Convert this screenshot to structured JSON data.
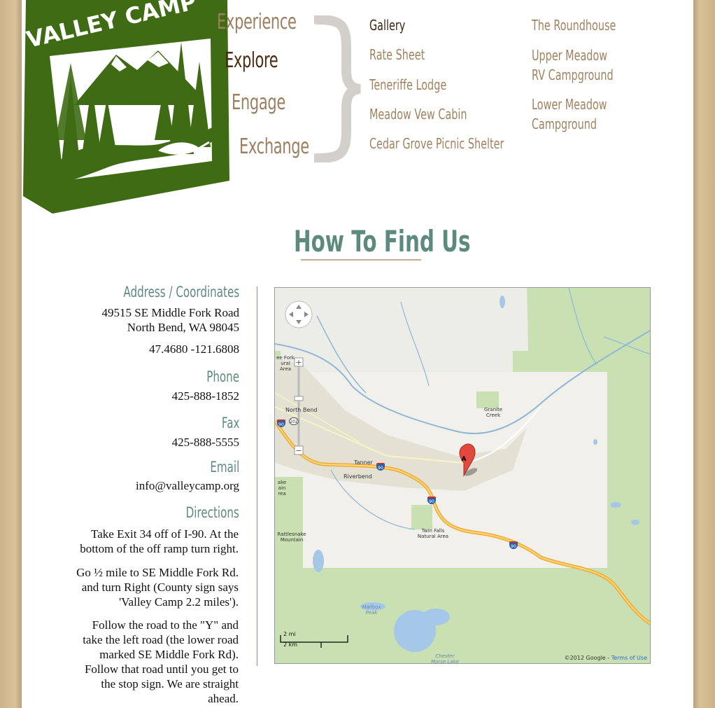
{
  "logo": {
    "text": "VALLEY CAMP"
  },
  "nav": {
    "pillars": [
      {
        "label": "Experience"
      },
      {
        "label": "Explore"
      },
      {
        "label": "Engage"
      },
      {
        "label": "Exchange"
      }
    ],
    "sub_col1": [
      {
        "label": "Gallery",
        "active": true
      },
      {
        "label": "Rate Sheet"
      },
      {
        "label": "Teneriffe Lodge"
      },
      {
        "label": "Meadow Vew Cabin"
      },
      {
        "label": "Cedar Grove Picnic Shelter"
      }
    ],
    "sub_col2": [
      {
        "line1": "The Roundhouse",
        "line2": ""
      },
      {
        "line1": "Upper Meadow",
        "line2": "RV Campground"
      },
      {
        "line1": "Lower Meadow",
        "line2": "Campground"
      }
    ]
  },
  "page": {
    "title": "How To Find Us"
  },
  "contact": {
    "address_label": "Address / Coordinates",
    "address_line1": "49515 SE Middle Fork Road",
    "address_line2": "North Bend, WA 98045",
    "coordinates": "47.4680  -121.6808",
    "phone_label": "Phone",
    "phone": "425-888-1852",
    "fax_label": "Fax",
    "fax": "425-888-5555",
    "email_label": "Email",
    "email": "info@valleycamp.org",
    "directions_label": "Directions",
    "directions": [
      [
        "Take Exit 34 off of I-90. At the",
        "bottom of the off ramp turn right."
      ],
      [
        "Go ½ mile to SE Middle Fork Rd.",
        "and turn Right (County sign says",
        "'Valley Camp 2.2 miles')."
      ],
      [
        "Follow the road to the \"Y\" and",
        "take the left road (the lower road",
        "marked SE Middle Fork Rd).",
        "Follow that road until you get to",
        "the stop sign. We are straight",
        "ahead."
      ]
    ]
  },
  "map": {
    "places": [
      "North Bend",
      "Tanner",
      "Riverbend",
      "Granite Creek",
      "Twin Falls Natural Area",
      "Rattlesnake Mountain",
      "Mailbox Peak",
      "Chester Morse Lake",
      "ee Fork ural Area",
      "ake ain rea"
    ],
    "shields": [
      "90",
      "202",
      "90",
      "90",
      "90"
    ],
    "marker": "A",
    "scale_mi": "2 mi",
    "scale_km": "2 km",
    "copyright": "©2012 Google - ",
    "terms": "Terms of Use"
  },
  "colors": {
    "brand_green": "#3e6b14",
    "nav_tan": "#a1825f",
    "nav_dark": "#4a2c12",
    "heading_teal": "#5d8a7f",
    "frame_tan": "#d2b98c"
  }
}
